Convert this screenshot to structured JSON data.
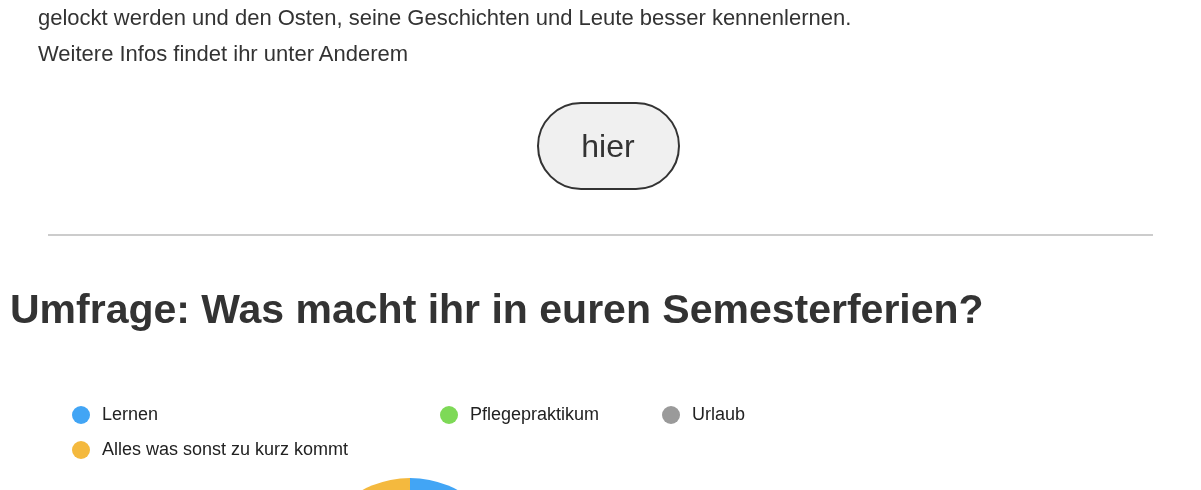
{
  "intro": {
    "lines": [
      "gelockt werden und den Osten, seine Geschichten und Leute besser kennenlernen.",
      "Weitere Infos findet ihr unter Anderem"
    ]
  },
  "link_button": {
    "label": "hier"
  },
  "poll": {
    "title": "Umfrage: Was macht ihr in euren Semesterferien?",
    "legend": [
      {
        "label": "Lernen",
        "color": "#42a5f5"
      },
      {
        "label": "Pflegepraktikum",
        "color": "#7ed957"
      },
      {
        "label": "Urlaub",
        "color": "#9a9a9a"
      },
      {
        "label": "Alles was sonst zu kurz kommt",
        "color": "#f4b93e"
      }
    ]
  }
}
